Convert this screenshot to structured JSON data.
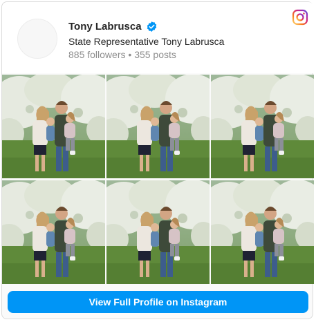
{
  "profile": {
    "name": "Tony Labrusca",
    "bio": "State Representative Tony Labrusca",
    "followers": "885 followers",
    "posts": "355 posts",
    "separator": "•",
    "verified_icon": "verified-badge-icon",
    "brand_icon": "instagram-icon"
  },
  "posts": [
    {
      "id": "post-1"
    },
    {
      "id": "post-2"
    },
    {
      "id": "post-3"
    },
    {
      "id": "post-4"
    },
    {
      "id": "post-5"
    },
    {
      "id": "post-6"
    }
  ],
  "cta": {
    "label": "View Full Profile on Instagram"
  },
  "colors": {
    "accent": "#0095f6",
    "verified": "#0095f6"
  }
}
